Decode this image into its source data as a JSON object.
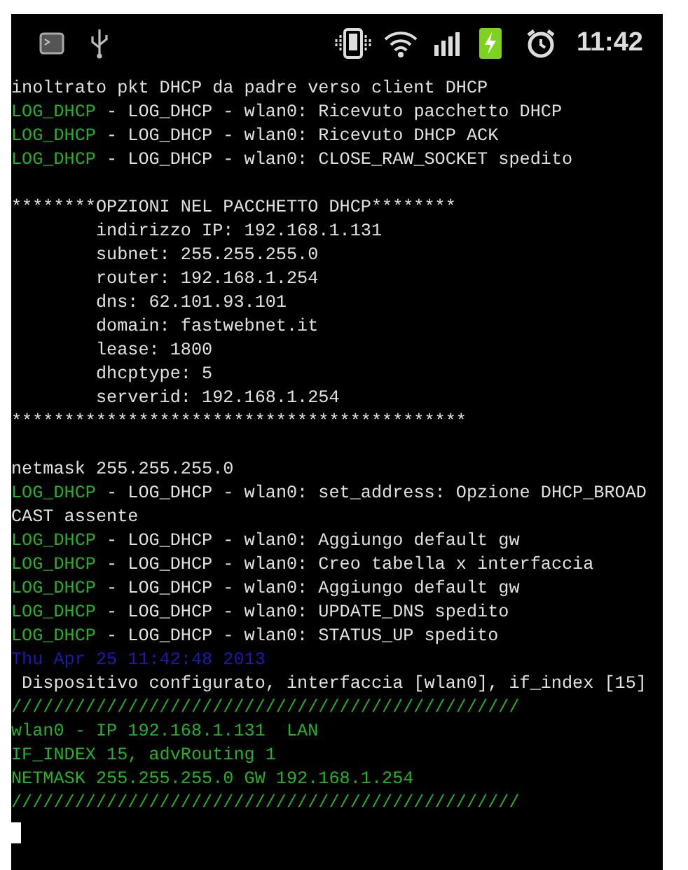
{
  "status_bar": {
    "time": "11:42"
  },
  "terminal": {
    "lines": [
      {
        "kind": "text",
        "segments": [
          {
            "text": "inoltrato pkt DHCP da padre verso client DHCP",
            "color": "#e0e0e0"
          }
        ]
      },
      {
        "kind": "text",
        "segments": [
          {
            "text": "LOG_DHCP",
            "color": "#22b422"
          },
          {
            "text": " - LOG_DHCP - wlan0: Ricevuto pacchetto DHCP",
            "color": "#e0e0e0"
          }
        ]
      },
      {
        "kind": "text",
        "segments": [
          {
            "text": "LOG_DHCP",
            "color": "#22b422"
          },
          {
            "text": " - LOG_DHCP - wlan0: Ricevuto DHCP ACK",
            "color": "#e0e0e0"
          }
        ]
      },
      {
        "kind": "text",
        "segments": [
          {
            "text": "LOG_DHCP",
            "color": "#22b422"
          },
          {
            "text": " - LOG_DHCP - wlan0: CLOSE_RAW_SOCKET spedito",
            "color": "#e0e0e0"
          }
        ]
      },
      {
        "kind": "blank"
      },
      {
        "kind": "text",
        "segments": [
          {
            "text": "********OPZIONI NEL PACCHETTO DHCP********",
            "color": "#e0e0e0"
          }
        ]
      },
      {
        "kind": "text",
        "segments": [
          {
            "text": "        indirizzo IP: 192.168.1.131",
            "color": "#e0e0e0"
          }
        ]
      },
      {
        "kind": "text",
        "segments": [
          {
            "text": "        subnet: 255.255.255.0",
            "color": "#e0e0e0"
          }
        ]
      },
      {
        "kind": "text",
        "segments": [
          {
            "text": "        router: 192.168.1.254",
            "color": "#e0e0e0"
          }
        ]
      },
      {
        "kind": "text",
        "segments": [
          {
            "text": "        dns: 62.101.93.101",
            "color": "#e0e0e0"
          }
        ]
      },
      {
        "kind": "text",
        "segments": [
          {
            "text": "        domain: fastwebnet.it",
            "color": "#e0e0e0"
          }
        ]
      },
      {
        "kind": "text",
        "segments": [
          {
            "text": "        lease: 1800",
            "color": "#e0e0e0"
          }
        ]
      },
      {
        "kind": "text",
        "segments": [
          {
            "text": "        dhcptype: 5",
            "color": "#e0e0e0"
          }
        ]
      },
      {
        "kind": "text",
        "segments": [
          {
            "text": "        serverid: 192.168.1.254",
            "color": "#e0e0e0"
          }
        ]
      },
      {
        "kind": "text",
        "segments": [
          {
            "text": "*******************************************",
            "color": "#e0e0e0"
          }
        ]
      },
      {
        "kind": "blank"
      },
      {
        "kind": "text",
        "segments": [
          {
            "text": "netmask 255.255.255.0",
            "color": "#e0e0e0"
          }
        ]
      },
      {
        "kind": "text",
        "segments": [
          {
            "text": "LOG_DHCP",
            "color": "#22b422"
          },
          {
            "text": " - LOG_DHCP - wlan0: set_address: Opzione DHCP_BROAD",
            "color": "#e0e0e0"
          }
        ]
      },
      {
        "kind": "text",
        "segments": [
          {
            "text": "CAST assente",
            "color": "#e0e0e0"
          }
        ]
      },
      {
        "kind": "text",
        "segments": [
          {
            "text": "LOG_DHCP",
            "color": "#22b422"
          },
          {
            "text": " - LOG_DHCP - wlan0: Aggiungo default gw",
            "color": "#e0e0e0"
          }
        ]
      },
      {
        "kind": "text",
        "segments": [
          {
            "text": "LOG_DHCP",
            "color": "#22b422"
          },
          {
            "text": " - LOG_DHCP - wlan0: Creo tabella x interfaccia",
            "color": "#e0e0e0"
          }
        ]
      },
      {
        "kind": "text",
        "segments": [
          {
            "text": "LOG_DHCP",
            "color": "#22b422"
          },
          {
            "text": " - LOG_DHCP - wlan0: Aggiungo default gw",
            "color": "#e0e0e0"
          }
        ]
      },
      {
        "kind": "text",
        "segments": [
          {
            "text": "LOG_DHCP",
            "color": "#22b422"
          },
          {
            "text": " - LOG_DHCP - wlan0: UPDATE_DNS spedito",
            "color": "#e0e0e0"
          }
        ]
      },
      {
        "kind": "text",
        "segments": [
          {
            "text": "LOG_DHCP",
            "color": "#22b422"
          },
          {
            "text": " - LOG_DHCP - wlan0: STATUS_UP spedito",
            "color": "#e0e0e0"
          }
        ]
      },
      {
        "kind": "text",
        "segments": [
          {
            "text": "Thu Apr 25 11:42:48 2013",
            "color": "#1a1ab4"
          }
        ]
      },
      {
        "kind": "text",
        "segments": [
          {
            "text": " Dispositivo configurato, interfaccia [wlan0], if_index [15]",
            "color": "#e0e0e0"
          }
        ]
      },
      {
        "kind": "text",
        "segments": [
          {
            "text": "////////////////////////////////////////////////",
            "color": "#22b422"
          }
        ]
      },
      {
        "kind": "text",
        "segments": [
          {
            "text": "wlan0 - IP 192.168.1.131  LAN",
            "color": "#22b422"
          }
        ]
      },
      {
        "kind": "text",
        "segments": [
          {
            "text": "IF_INDEX 15, advRouting 1",
            "color": "#22b422"
          }
        ]
      },
      {
        "kind": "text",
        "segments": [
          {
            "text": "NETMASK 255.255.255.0 GW 192.168.1.254",
            "color": "#22b422"
          }
        ]
      },
      {
        "kind": "text",
        "segments": [
          {
            "text": "////////////////////////////////////////////////",
            "color": "#22b422"
          }
        ]
      }
    ],
    "cursor": true
  }
}
